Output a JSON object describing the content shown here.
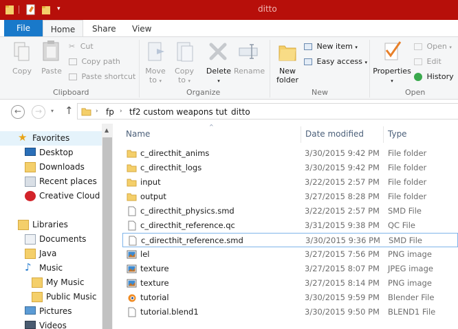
{
  "window": {
    "title": "ditto"
  },
  "ribbon": {
    "tabs": {
      "file": "File",
      "home": "Home",
      "share": "Share",
      "view": "View"
    },
    "clipboard": {
      "copy": "Copy",
      "paste": "Paste",
      "cut": "Cut",
      "copy_path": "Copy path",
      "paste_shortcut": "Paste shortcut",
      "group_label": "Clipboard"
    },
    "organize": {
      "move_to": [
        "Move",
        "to"
      ],
      "copy_to": [
        "Copy",
        "to"
      ],
      "delete": "Delete",
      "rename": "Rename",
      "group_label": "Organize"
    },
    "new": {
      "new_folder": [
        "New",
        "folder"
      ],
      "new_item": "New item",
      "easy_access": "Easy access",
      "group_label": "New"
    },
    "open": {
      "properties": "Properties",
      "open": "Open",
      "edit": "Edit",
      "history": "History",
      "group_label": "Open"
    }
  },
  "address": {
    "breadcrumbs": [
      "fp",
      "tf2 custom weapons tut",
      "ditto"
    ]
  },
  "nav_pane": {
    "favorites_header": "Favorites",
    "favorites": [
      "Desktop",
      "Downloads",
      "Recent places",
      "Creative Cloud Fi"
    ],
    "libraries_header": "Libraries",
    "libraries": [
      "Documents",
      "Java",
      "Music",
      "My Music",
      "Public Music",
      "Pictures",
      "Videos"
    ]
  },
  "file_list": {
    "columns": {
      "name": "Name",
      "date": "Date modified",
      "type": "Type"
    },
    "rows": [
      {
        "name": "c_directhit_anims",
        "date": "3/30/2015 9:42 PM",
        "type": "File folder",
        "icon": "folder-icon"
      },
      {
        "name": "c_directhit_logs",
        "date": "3/30/2015 9:42 PM",
        "type": "File folder",
        "icon": "folder-icon"
      },
      {
        "name": "input",
        "date": "3/22/2015 2:57 PM",
        "type": "File folder",
        "icon": "folder-icon"
      },
      {
        "name": "output",
        "date": "3/27/2015 8:28 PM",
        "type": "File folder",
        "icon": "folder-icon"
      },
      {
        "name": "c_directhit_physics.smd",
        "date": "3/22/2015 2:57 PM",
        "type": "SMD File",
        "icon": "document-icon"
      },
      {
        "name": "c_directhit_reference.qc",
        "date": "3/31/2015 9:38 PM",
        "type": "QC File",
        "icon": "document-icon"
      },
      {
        "name": "c_directhit_reference.smd",
        "date": "3/30/2015 9:36 PM",
        "type": "SMD File",
        "icon": "document-icon",
        "selected": true
      },
      {
        "name": "lel",
        "date": "3/27/2015 7:56 PM",
        "type": "PNG image",
        "icon": "image-icon"
      },
      {
        "name": "texture",
        "date": "3/27/2015 8:07 PM",
        "type": "JPEG image",
        "icon": "image-icon"
      },
      {
        "name": "texture",
        "date": "3/27/2015 8:14 PM",
        "type": "PNG image",
        "icon": "image-icon"
      },
      {
        "name": "tutorial",
        "date": "3/30/2015 9:59 PM",
        "type": "Blender File",
        "icon": "blender-icon"
      },
      {
        "name": "tutorial.blend1",
        "date": "3/30/2015 9:50 PM",
        "type": "BLEND1 File",
        "icon": "document-icon"
      }
    ]
  },
  "colors": {
    "titlebar": "#b70f0a",
    "file_tab": "#1979ca",
    "folder": "#e8b94a",
    "selection_border": "#7eb4ea"
  }
}
